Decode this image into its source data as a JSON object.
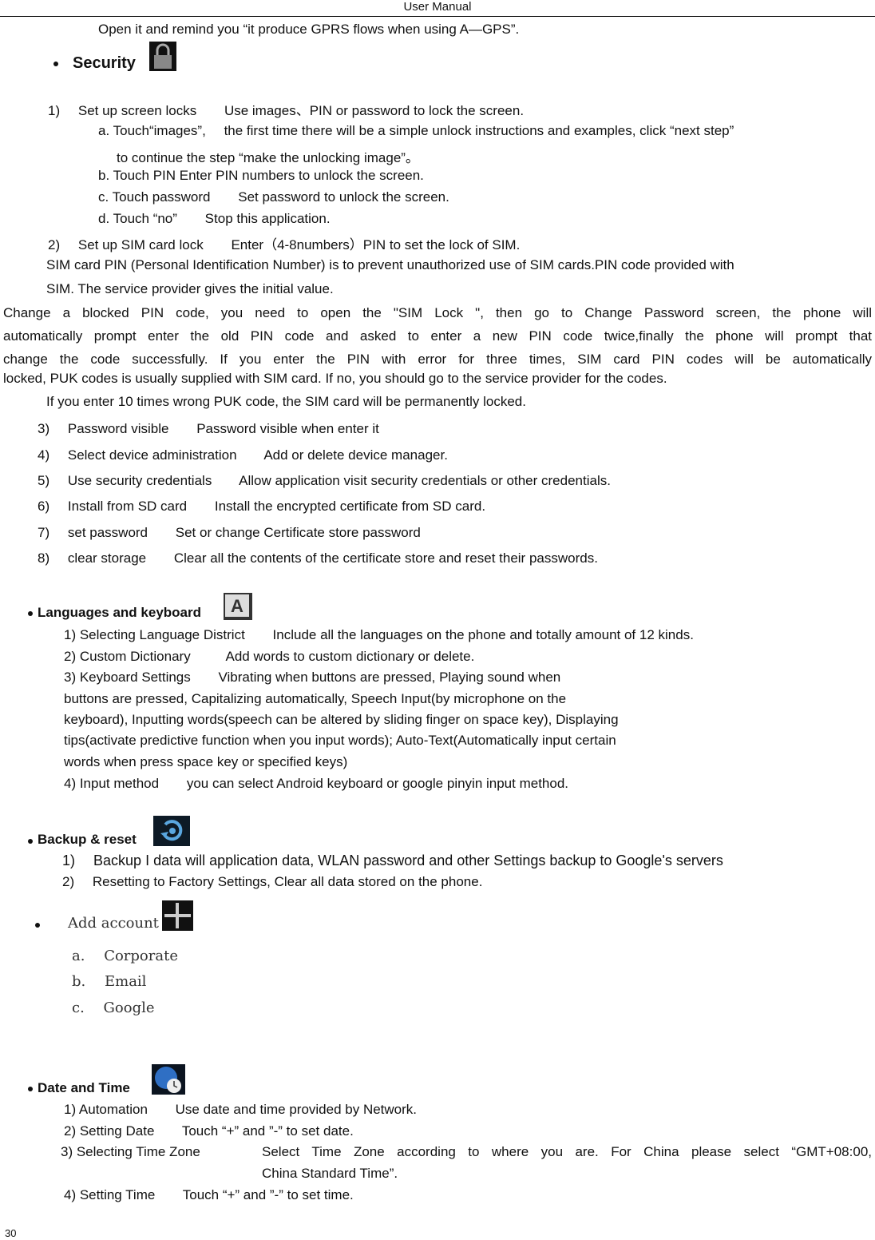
{
  "header": {
    "title": "User    Manual"
  },
  "intro_line": "Open it and remind you “it produce GPRS flows when using A—GPS”.",
  "security": {
    "heading": "Security",
    "icon": "lock-icon",
    "items": [
      {
        "num": "1)",
        "label": "Set up screen locks",
        "desc": "Use images、PIN or password to lock the screen."
      },
      {
        "num": "a.",
        "label": "Touch“images”,",
        "desc": "the first time there will be a simple unlock instructions and examples, click “next step”"
      },
      {
        "num": "",
        "label": "",
        "desc": "to continue the step “make the unlocking image”。"
      },
      {
        "num": "b.",
        "label": "Touch PIN Enter PIN numbers to unlock the screen.",
        "desc": ""
      },
      {
        "num": "c.",
        "label": "Touch password",
        "desc": "Set password to unlock the screen."
      },
      {
        "num": "d.",
        "label": "Touch “no”",
        "desc": "Stop this application."
      },
      {
        "num": "2)",
        "label": "Set up SIM card lock",
        "desc": "Enter（4-8numbers）PIN to set the lock of SIM."
      }
    ],
    "sim_pin_para_1": "SIM card PIN (Personal Identification Number) is to prevent unauthorized use of SIM cards.PIN code provided with",
    "sim_pin_para_2": "SIM. The service provider gives the initial value.",
    "blocked_pin_lines": [
      "Change a blocked PIN code, you need to open the \"SIM Lock \", then go to Change Password screen, the phone will",
      "automatically prompt enter the old PIN code and asked to enter a new PIN code twice,finally the phone will prompt that",
      "change the code successfully. If you enter the PIN with error for three times, SIM card PIN codes will be automatically",
      "locked, PUK codes is usually supplied with SIM card. If no, you should go to the service provider for the codes."
    ],
    "puk_line": "If you enter 10 times wrong PUK code, the SIM card will be permanently locked.",
    "more_items": [
      {
        "num": "3)",
        "label": "Password visible",
        "desc": "Password visible when enter it"
      },
      {
        "num": "4)",
        "label": "Select device administration",
        "desc": "Add or delete device manager."
      },
      {
        "num": "5)",
        "label": "Use security credentials",
        "desc": "Allow application visit security credentials or other credentials."
      },
      {
        "num": "6)",
        "label": "Install from SD card",
        "desc": "Install the encrypted certificate from SD card."
      },
      {
        "num": "7)",
        "label": "set password",
        "desc": "Set or change Certificate store password"
      },
      {
        "num": "8)",
        "label": "clear storage",
        "desc": "Clear all the contents of the certificate store and reset their passwords."
      }
    ]
  },
  "languages": {
    "heading": "Languages and keyboard",
    "icon": "keyboard-a-icon",
    "items": [
      {
        "label": "1) Selecting Language District",
        "desc": "Include all the languages on the phone and totally amount of 12 kinds."
      },
      {
        "label": "2) Custom Dictionary",
        "desc": "Add words to custom dictionary or delete."
      },
      {
        "label": "3) Keyboard Settings",
        "desc": "Vibrating when buttons are pressed, Playing sound when"
      }
    ],
    "keyboard_continuation": [
      "buttons are pressed, Capitalizing automatically, Speech Input(by microphone on the",
      "keyboard), Inputting words(speech can be altered by sliding finger on space key), Displaying",
      "tips(activate predictive function when you input words); Auto-Text(Automatically input certain",
      "words when press space key or specified keys)"
    ],
    "input_method": {
      "label": "4) Input method",
      "desc": "you can select Android keyboard or google pinyin input method."
    }
  },
  "backup": {
    "heading": "Backup & reset",
    "icon": "backup-restore-icon",
    "items": [
      {
        "num": "1)",
        "text": "Backup I data will application data, WLAN password and other Settings backup to Google's servers"
      },
      {
        "num": "2)",
        "text": "Resetting to Factory Settings, Clear all data stored on the phone."
      }
    ]
  },
  "add_account": {
    "heading": "Add account",
    "icon": "plus-icon",
    "items": [
      {
        "num": "a.",
        "text": "Corporate"
      },
      {
        "num": "b.",
        "text": "Email"
      },
      {
        "num": "c.",
        "text": "Google"
      }
    ]
  },
  "date_time": {
    "heading": "Date and Time",
    "icon": "globe-clock-icon",
    "items": [
      {
        "label": "1) Automation",
        "desc": "Use date and time provided by Network."
      },
      {
        "label": "2) Setting Date",
        "desc": "Touch “+” and ”-” to set date."
      },
      {
        "label": "3) Selecting Time Zone",
        "desc": "Select Time Zone according to where you are. For China please select “GMT+08:00,",
        "desc2": "China Standard Time”."
      },
      {
        "label": "4) Setting Time",
        "desc": "Touch “+” and ”-” to set time."
      }
    ]
  },
  "footer": {
    "page_number": "30"
  }
}
